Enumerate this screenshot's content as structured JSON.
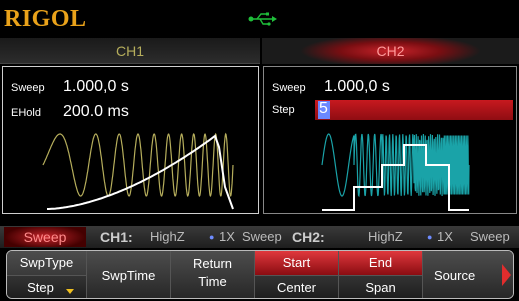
{
  "brand": {
    "logo": "RIGOL"
  },
  "header": {
    "ch1": "CH1",
    "ch2": "CH2"
  },
  "ch1": {
    "sweep_label": "Sweep",
    "sweep_value": "1.000,0 s",
    "ehold_label": "EHold",
    "ehold_value": "200.0 ms"
  },
  "ch2": {
    "sweep_label": "Sweep",
    "sweep_value": "1.000,0 s",
    "step_label": "Step",
    "step_value": "5"
  },
  "status": {
    "mode": "Sweep",
    "ch1_label": "CH1:",
    "ch1_imp": "HighZ",
    "ch1_dot": "●",
    "ch1_x": "1X",
    "ch1_mode": "Sweep",
    "ch2_label": "CH2:",
    "ch2_imp": "HighZ",
    "ch2_dot": "●",
    "ch2_x": "1X",
    "ch2_mode": "Sweep"
  },
  "softkeys": {
    "swptype_top": "SwpType",
    "swptype_bottom": "Step",
    "swptime": "SwpTime",
    "return_line1": "Return",
    "return_line2": "Time",
    "start": "Start",
    "center": "Center",
    "end": "End",
    "span": "Span",
    "source": "Source"
  },
  "colors": {
    "ch1": "#b6ae5c",
    "ch2_accent": "#c8232a",
    "ch2_wave": "#1aa3a8",
    "logo": "#e9a21a"
  },
  "icons": {
    "usb": "usb-icon",
    "next_page": "arrow-right-icon",
    "dropdown": "triangle-down-icon"
  }
}
